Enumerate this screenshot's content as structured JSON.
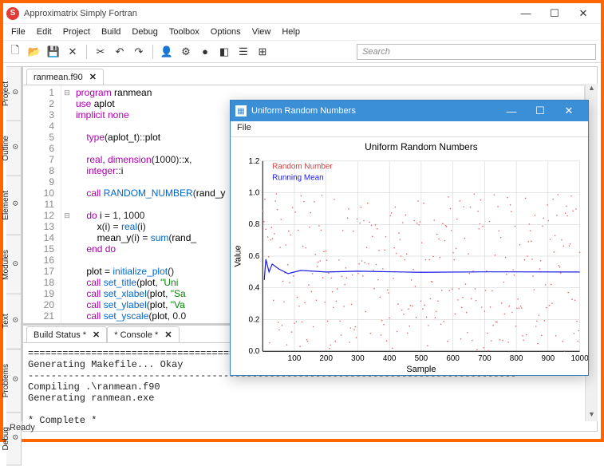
{
  "app": {
    "title": "Approximatrix Simply Fortran"
  },
  "menu": [
    "File",
    "Edit",
    "Project",
    "Build",
    "Debug",
    "Toolbox",
    "Options",
    "View",
    "Help"
  ],
  "search": {
    "placeholder": "Search"
  },
  "sidetabs": [
    "Project",
    "Outline",
    "Element Search",
    "Modules",
    "Text Search",
    "Problems",
    "Debug"
  ],
  "tabs": {
    "editor": "ranmean.f90"
  },
  "code": {
    "lines": [
      {
        "n": 1,
        "fold": "⊟",
        "html": "<span class='kw'>program</span> <span class='id'>ranmean</span>"
      },
      {
        "n": 2,
        "html": "<span class='kw'>use</span> <span class='id'>aplot</span>"
      },
      {
        "n": 3,
        "html": "<span class='kw'>implicit none</span>"
      },
      {
        "n": 4,
        "html": ""
      },
      {
        "n": 5,
        "html": "    <span class='kw'>type</span>(<span class='id'>aplot_t</span>)::<span class='id'>plot</span>"
      },
      {
        "n": 6,
        "html": ""
      },
      {
        "n": 7,
        "html": "    <span class='kw'>real</span>, <span class='kw'>dimension</span>(1000)::<span class='id'>x</span>,"
      },
      {
        "n": 8,
        "html": "    <span class='kw'>integer</span>::<span class='id'>i</span>"
      },
      {
        "n": 9,
        "html": ""
      },
      {
        "n": 10,
        "html": "    <span class='kw'>call</span> <span class='fn'>RANDOM_NUMBER</span>(<span class='id'>rand_y</span>"
      },
      {
        "n": 11,
        "html": ""
      },
      {
        "n": 12,
        "fold": "⊟",
        "html": "    <span class='kw'>do</span> <span class='id'>i</span> = 1, 1000"
      },
      {
        "n": 13,
        "html": "        <span class='id'>x</span>(<span class='id'>i</span>) = <span class='fn'>real</span>(<span class='id'>i</span>)"
      },
      {
        "n": 14,
        "html": "        <span class='id'>mean_y</span>(<span class='id'>i</span>) = <span class='fn'>sum</span>(<span class='id'>rand_</span>"
      },
      {
        "n": 15,
        "html": "    <span class='kw'>end do</span>"
      },
      {
        "n": 16,
        "html": ""
      },
      {
        "n": 17,
        "html": "    <span class='id'>plot</span> = <span class='fn'>initialize_plot</span>()"
      },
      {
        "n": 18,
        "html": "    <span class='kw'>call</span> <span class='fn'>set_title</span>(<span class='id'>plot</span>, <span class='str'>\"Uni</span>"
      },
      {
        "n": 19,
        "html": "    <span class='kw'>call</span> <span class='fn'>set_xlabel</span>(<span class='id'>plot</span>, <span class='str'>\"Sa</span>"
      },
      {
        "n": 20,
        "html": "    <span class='kw'>call</span> <span class='fn'>set_ylabel</span>(<span class='id'>plot</span>, <span class='str'>\"Va</span>"
      },
      {
        "n": 21,
        "html": "    <span class='kw'>call</span> <span class='fn'>set_yscale</span>(<span class='id'>plot</span>, 0.0"
      }
    ]
  },
  "bottomtabs": [
    {
      "label": "Build Status *",
      "active": true
    },
    {
      "label": "* Console *",
      "active": false
    }
  ],
  "console": "=====================================================================================\nGenerating Makefile... Okay\n-------------------------------------------------------------------------------------\nCompiling .\\ranmean.f90\nGenerating ranmean.exe\n\n* Complete *",
  "status": "Ready",
  "plot": {
    "title": "Uniform Random Numbers",
    "menu": "File",
    "legend": [
      "Random Number",
      "Running Mean"
    ]
  },
  "chart_data": {
    "type": "scatter",
    "title": "Uniform Random Numbers",
    "xlabel": "Sample",
    "ylabel": "Value",
    "xlim": [
      0,
      1000
    ],
    "ylim": [
      0,
      1.2
    ],
    "xticks": [
      100,
      200,
      300,
      400,
      500,
      600,
      700,
      800,
      900,
      1000
    ],
    "yticks": [
      0,
      0.2,
      0.4,
      0.6,
      0.8,
      1.0,
      1.2
    ],
    "series": [
      {
        "name": "Random Number",
        "type": "scatter",
        "color": "#e06666",
        "n": 1000,
        "distribution": "uniform[0,1]"
      },
      {
        "name": "Running Mean",
        "type": "line",
        "color": "#1a1ae6",
        "converges_to": 0.5,
        "sample_points": [
          {
            "x": 5,
            "y": 0.45
          },
          {
            "x": 10,
            "y": 0.58
          },
          {
            "x": 20,
            "y": 0.5
          },
          {
            "x": 30,
            "y": 0.55
          },
          {
            "x": 50,
            "y": 0.52
          },
          {
            "x": 80,
            "y": 0.49
          },
          {
            "x": 120,
            "y": 0.51
          },
          {
            "x": 200,
            "y": 0.5
          },
          {
            "x": 300,
            "y": 0.505
          },
          {
            "x": 500,
            "y": 0.498
          },
          {
            "x": 700,
            "y": 0.501
          },
          {
            "x": 1000,
            "y": 0.5
          }
        ]
      }
    ]
  }
}
